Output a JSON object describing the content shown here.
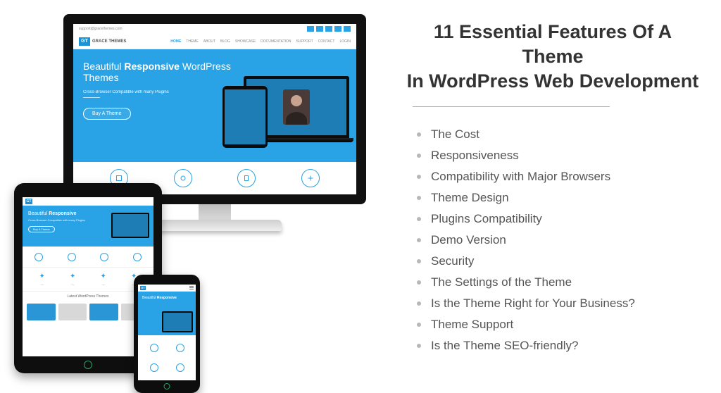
{
  "title_line1": "11 Essential Features Of A Theme",
  "title_line2": "In WordPress Web Development",
  "features": [
    "The Cost",
    "Responsiveness",
    "Compatibility with Major Browsers",
    "Theme Design",
    "Plugins Compatibility",
    "Demo Version",
    "Security",
    "The Settings of the Theme",
    "Is the Theme Right for Your Business?",
    "Theme Support",
    "Is the Theme SEO-friendly?"
  ],
  "mock": {
    "brand_initials": "GT",
    "brand_name": "GRACE THEMES",
    "topbar_contact": "support@gracethemes.com",
    "nav": [
      "HOME",
      "THEME",
      "ABOUT",
      "BLOG",
      "SHOWCASE",
      "DOCUMENTATION",
      "SUPPORT",
      "CONTACT",
      "LOGIN"
    ],
    "hero_pre": "Beautiful ",
    "hero_bold": "Responsive",
    "hero_post": " WordPress",
    "hero_line2": "Themes",
    "hero_tagline": "Cross-Browser Compatible with many Plugins",
    "hero_cta": "Buy A Theme",
    "tablet_section": "Latest WordPress Themes"
  }
}
